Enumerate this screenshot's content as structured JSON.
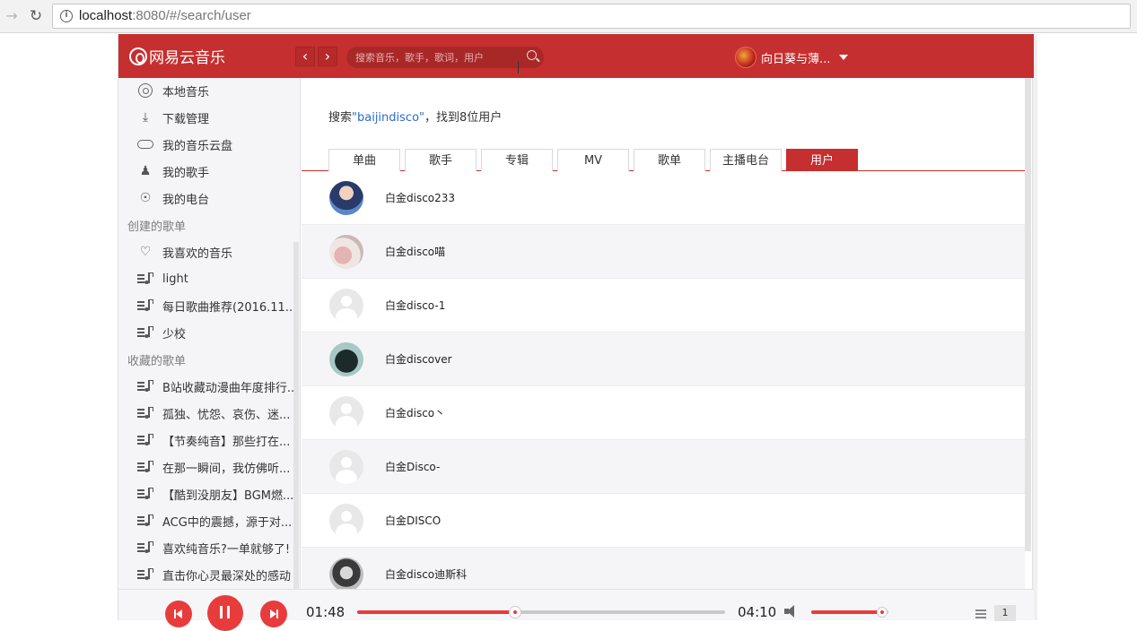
{
  "browser": {
    "url_host": "localhost",
    "url_path": ":8080/#/search/user"
  },
  "header": {
    "logo_text": "网易云音乐",
    "search_placeholder": "搜索音乐，歌手，歌词，用户",
    "username": "向日葵与薄..."
  },
  "sidebar": {
    "my_items": [
      {
        "label": "本地音乐",
        "icon": "disc-icon"
      },
      {
        "label": "下载管理",
        "icon": "download-icon"
      },
      {
        "label": "我的音乐云盘",
        "icon": "cloud-icon"
      },
      {
        "label": "我的歌手",
        "icon": "person-icon"
      },
      {
        "label": "我的电台",
        "icon": "radio-icon"
      }
    ],
    "created_heading": "创建的歌单",
    "created_items": [
      {
        "label": "我喜欢的音乐",
        "icon": "heart-icon"
      },
      {
        "label": "light",
        "icon": "playlist-icon"
      },
      {
        "label": "每日歌曲推荐(2016.11...",
        "icon": "playlist-icon"
      },
      {
        "label": "少校",
        "icon": "playlist-icon"
      }
    ],
    "collected_heading": "收藏的歌单",
    "collected_items": [
      {
        "label": "B站收藏动漫曲年度排行...",
        "icon": "playlist-icon"
      },
      {
        "label": "孤独、忧怨、哀伤、迷...",
        "icon": "playlist-icon"
      },
      {
        "label": "【节奏纯音】那些打在...",
        "icon": "playlist-icon"
      },
      {
        "label": "在那一瞬间，我仿佛听...",
        "icon": "playlist-icon"
      },
      {
        "label": "【酷到没朋友】BGM燃...",
        "icon": "playlist-icon"
      },
      {
        "label": "ACG中的震撼，源于对...",
        "icon": "playlist-icon"
      },
      {
        "label": "喜欢纯音乐?一单就够了!",
        "icon": "playlist-icon"
      },
      {
        "label": "直击你心灵最深处的感动",
        "icon": "playlist-icon"
      }
    ]
  },
  "search": {
    "prefix": "搜索",
    "keyword": "\"baijindisco\"",
    "suffix": "，找到8位用户"
  },
  "tabs": [
    {
      "label": "单曲"
    },
    {
      "label": "歌手"
    },
    {
      "label": "专辑"
    },
    {
      "label": "MV"
    },
    {
      "label": "歌单"
    },
    {
      "label": "主播电台"
    },
    {
      "label": "用户"
    }
  ],
  "active_tab": "用户",
  "users": [
    {
      "name": "白金disco233",
      "avatar": "photo-anime"
    },
    {
      "name": "白金disco喵",
      "avatar": "photo-pastel"
    },
    {
      "name": "白金disco-1",
      "avatar": "default"
    },
    {
      "name": "白金discover",
      "avatar": "photo-hoodie"
    },
    {
      "name": "白金disco丶",
      "avatar": "default"
    },
    {
      "name": "白金Disco-",
      "avatar": "default"
    },
    {
      "name": "白金DISCO",
      "avatar": "default"
    },
    {
      "name": "白金disco迪斯科",
      "avatar": "photo-portrait"
    }
  ],
  "player": {
    "current_time": "01:48",
    "total_time": "04:10",
    "progress": 0.43,
    "volume": 0.92,
    "playlist_count": "1"
  },
  "colors": {
    "brand_red": "#c62f2f",
    "accent_red": "#e83c3c",
    "link_blue": "#2e6bc5"
  }
}
